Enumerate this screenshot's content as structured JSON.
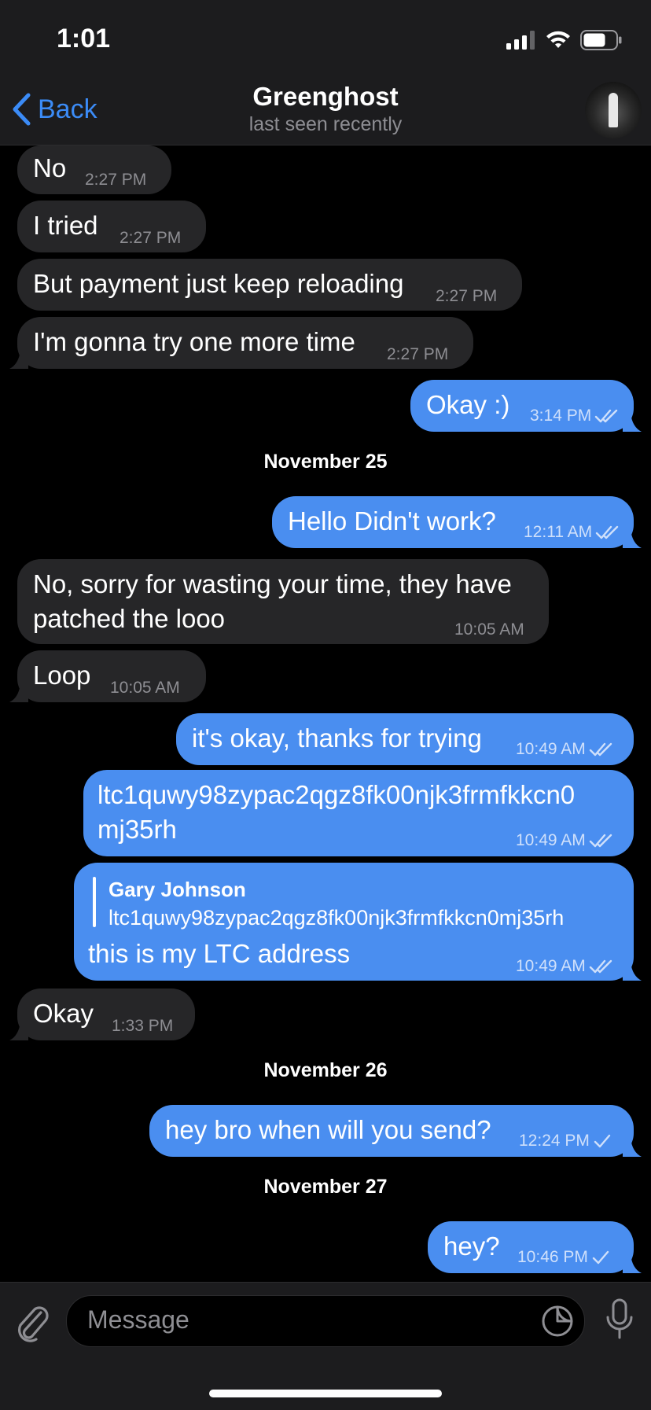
{
  "status_bar": {
    "time": "1:01"
  },
  "header": {
    "back_label": "Back",
    "contact_name": "Greenghost",
    "contact_status": "last seen recently"
  },
  "messages": [
    {
      "text": "No",
      "time": "2:27 PM",
      "direction": "incoming"
    },
    {
      "text": "I tried",
      "time": "2:27 PM",
      "direction": "incoming"
    },
    {
      "text": "But payment just keep reloading",
      "time": "2:27 PM",
      "direction": "incoming"
    },
    {
      "text": "I'm gonna try one more time",
      "time": "2:27 PM",
      "direction": "incoming"
    },
    {
      "text": "Okay :)",
      "time": "3:14 PM",
      "direction": "outgoing",
      "status": "read"
    },
    {
      "date": "November 25"
    },
    {
      "text": "Hello Didn't work?",
      "time": "12:11 AM",
      "direction": "outgoing",
      "status": "read"
    },
    {
      "text_line1": "No, sorry for wasting your time, they have",
      "text_line2": "patched the looo",
      "time": "10:05 AM",
      "direction": "incoming"
    },
    {
      "text": "Loop",
      "time": "10:05 AM",
      "direction": "incoming"
    },
    {
      "text": "it's okay, thanks for trying",
      "time": "10:49 AM",
      "direction": "outgoing",
      "status": "read"
    },
    {
      "text_line1": "ltc1quwy98zypac2qgz8fk00njk3frmfkkcn0",
      "text_line2": "mj35rh",
      "time": "10:49 AM",
      "direction": "outgoing",
      "status": "read"
    },
    {
      "reply_name": "Gary Johnson",
      "reply_text": "ltc1quwy98zypac2qgz8fk00njk3frmfkkcn0mj35rh",
      "text": "this is my LTC address",
      "time": "10:49 AM",
      "direction": "outgoing",
      "status": "read"
    },
    {
      "text": "Okay",
      "time": "1:33 PM",
      "direction": "incoming"
    },
    {
      "date": "November 26"
    },
    {
      "text": "hey bro when will you send?",
      "time": "12:24 PM",
      "direction": "outgoing",
      "status": "sent"
    },
    {
      "date": "November 27"
    },
    {
      "text": "hey?",
      "time": "10:46 PM",
      "direction": "outgoing",
      "status": "sent"
    }
  ],
  "composer": {
    "placeholder": "Message"
  },
  "icons": {
    "back": "chevron-left-icon",
    "attach": "paperclip-icon",
    "sticker": "sticker-icon",
    "mic": "microphone-icon",
    "read": "double-check-icon",
    "sent": "single-check-icon"
  },
  "colors": {
    "accent": "#3b8bf6",
    "outgoing_bubble": "#4a8ef0",
    "incoming_bubble": "#262628",
    "background": "#000000"
  }
}
